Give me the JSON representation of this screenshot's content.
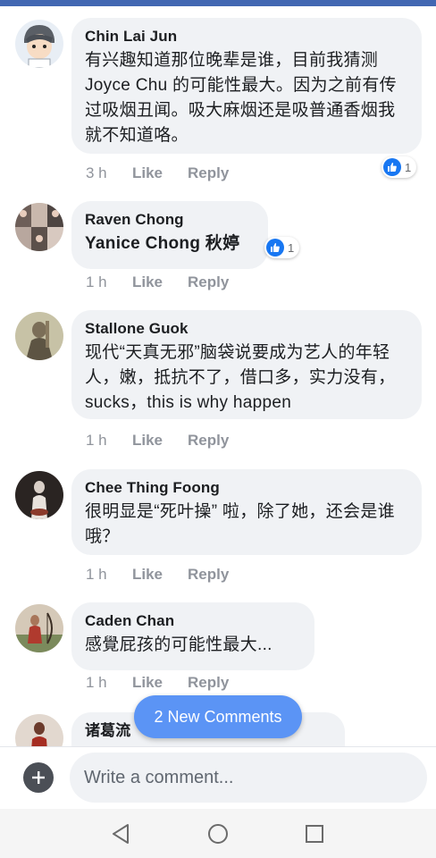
{
  "feed": {
    "comments": [
      {
        "author": "Chin Lai Jun",
        "text": "有兴趣知道那位晚辈是谁，目前我猜测 Joyce Chu 的可能性最大。因为之前有传过吸烟丑闻。吸大麻烟还是吸普通香烟我就不知道咯。",
        "time": "3 h",
        "like": "Like",
        "reply": "Reply",
        "reaction_count": "1",
        "avatar": "cartoon-boy-avatar"
      },
      {
        "author": "Raven Chong",
        "text": "Yanice Chong 秋婷",
        "time": "1 h",
        "like": "Like",
        "reply": "Reply",
        "reaction_count": "1",
        "avatar": "photo-collage-avatar"
      },
      {
        "author": "Stallone Guok",
        "text": "现代“天真无邪”脑袋说要成为艺人的年轻人，嫩，抵抗不了，借口多，实力没有，sucks，this is why happen",
        "time": "1 h",
        "like": "Like",
        "reply": "Reply",
        "avatar": "statue-avatar"
      },
      {
        "author": "Chee Thing Foong",
        "text": "很明显是“死叶操” 啦，除了她，还会是谁哦？",
        "time": "1 h",
        "like": "Like",
        "reply": "Reply",
        "avatar": "dark-portrait-avatar"
      },
      {
        "author": "Caden Chan",
        "text": "感覺屁孩的可能性最大...",
        "time": "1 h",
        "like": "Like",
        "reply": "Reply",
        "avatar": "archer-avatar"
      },
      {
        "author": "诸葛流",
        "avatar": "red-figure-avatar"
      }
    ]
  },
  "new_comments": {
    "label": "2 New Comments"
  },
  "composer": {
    "placeholder": "Write a comment..."
  },
  "navbar": {
    "icons": [
      "back-triangle-icon",
      "home-circle-icon",
      "recents-square-icon"
    ]
  },
  "colors": {
    "accent": "#4267b2",
    "pill": "#5b94f5",
    "bubble": "#f0f2f5",
    "like_blue": "#1877f2"
  }
}
